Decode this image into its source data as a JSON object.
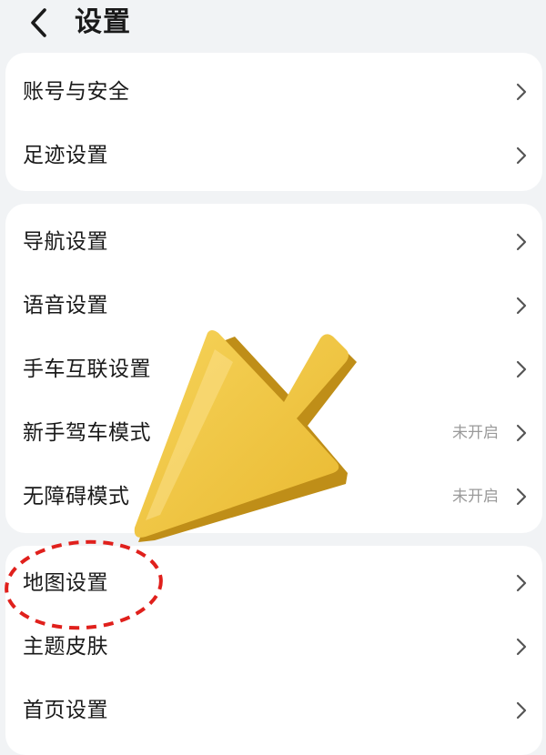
{
  "header": {
    "title": "设置",
    "back_icon": "chevron-left-icon"
  },
  "groups": [
    {
      "items": [
        {
          "label": "账号与安全",
          "status": ""
        },
        {
          "label": "足迹设置",
          "status": ""
        }
      ]
    },
    {
      "items": [
        {
          "label": "导航设置",
          "status": ""
        },
        {
          "label": "语音设置",
          "status": ""
        },
        {
          "label": "手车互联设置",
          "status": ""
        },
        {
          "label": "新手驾车模式",
          "status": "未开启"
        },
        {
          "label": "无障碍模式",
          "status": "未开启"
        }
      ]
    },
    {
      "items": [
        {
          "label": "地图设置",
          "status": ""
        },
        {
          "label": "主题皮肤",
          "status": ""
        },
        {
          "label": "首页设置",
          "status": ""
        }
      ]
    }
  ],
  "annotation": {
    "pointer_icon": "yellow-3d-arrow-icon",
    "highlight_color": "#e0201c",
    "arrow_color": "#f1c644",
    "highlighted_item": "地图设置"
  }
}
